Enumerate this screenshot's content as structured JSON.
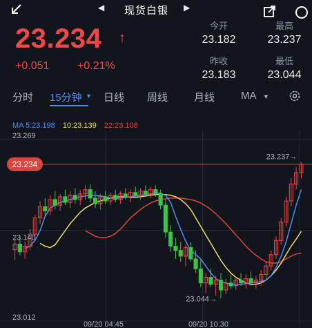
{
  "header": {
    "title": "现货白银",
    "prev_glyph": "◀",
    "next_glyph": "▶",
    "icons": [
      "back-arrow-icon",
      "share-icon",
      "search-icon"
    ]
  },
  "quote": {
    "price": "23.234",
    "arrow": "↑",
    "change": "+0.051",
    "change_pct": "+0.21%",
    "open_label": "今开",
    "open": "23.182",
    "high_label": "最高",
    "high": "23.237",
    "prev_close_label": "昨收",
    "prev_close": "23.183",
    "low_label": "最低",
    "low": "23.044"
  },
  "tabs": {
    "items": [
      "分时",
      "15分钟",
      "日线",
      "周线",
      "月线",
      "MA"
    ],
    "active": "15分钟",
    "dropdown_glyph": "▼"
  },
  "ma_legend": {
    "ma5": "MA 5:23.198",
    "ma10": "10:23.139",
    "ma22": "22:23.108"
  },
  "colors": {
    "up": "#ec4a4a",
    "down": "#3fc24a",
    "accent": "#4f8ff7",
    "ma5": "#4f8ff7",
    "ma10": "#f1dc6a",
    "ma22": "#d6473f",
    "background": "#12161c"
  },
  "chart_data": {
    "type": "candlestick",
    "ylim": [
      23.012,
      23.269
    ],
    "y_tick_labels": [
      "23.269",
      "23.140",
      "23.012"
    ],
    "x_tick_labels": [
      "09/20 04:45",
      "09/20 10:30"
    ],
    "current_price_label": "23.234",
    "high_annotation": "23.237→",
    "low_annotation": "23.044→",
    "candles": [
      [
        23.113,
        23.128,
        23.098,
        23.121
      ],
      [
        23.121,
        23.132,
        23.105,
        23.11
      ],
      [
        23.11,
        23.124,
        23.1,
        23.118
      ],
      [
        23.118,
        23.142,
        23.112,
        23.135
      ],
      [
        23.135,
        23.162,
        23.13,
        23.158
      ],
      [
        23.158,
        23.182,
        23.15,
        23.174
      ],
      [
        23.174,
        23.186,
        23.16,
        23.168
      ],
      [
        23.168,
        23.19,
        23.162,
        23.184
      ],
      [
        23.184,
        23.196,
        23.17,
        23.176
      ],
      [
        23.176,
        23.192,
        23.168,
        23.188
      ],
      [
        23.188,
        23.198,
        23.176,
        23.18
      ],
      [
        23.18,
        23.196,
        23.172,
        23.19
      ],
      [
        23.19,
        23.2,
        23.178,
        23.184
      ],
      [
        23.184,
        23.198,
        23.176,
        23.192
      ],
      [
        23.192,
        23.204,
        23.184,
        23.198
      ],
      [
        23.198,
        23.206,
        23.18,
        23.186
      ],
      [
        23.186,
        23.196,
        23.172,
        23.178
      ],
      [
        23.178,
        23.192,
        23.17,
        23.188
      ],
      [
        23.188,
        23.196,
        23.178,
        23.182
      ],
      [
        23.182,
        23.194,
        23.176,
        23.19
      ],
      [
        23.19,
        23.198,
        23.18,
        23.184
      ],
      [
        23.184,
        23.196,
        23.178,
        23.192
      ],
      [
        23.192,
        23.2,
        23.184,
        23.188
      ],
      [
        23.188,
        23.198,
        23.18,
        23.194
      ],
      [
        23.194,
        23.202,
        23.186,
        23.19
      ],
      [
        23.19,
        23.2,
        23.184,
        23.196
      ],
      [
        23.196,
        23.204,
        23.188,
        23.192
      ],
      [
        23.192,
        23.202,
        23.186,
        23.198
      ],
      [
        23.198,
        23.204,
        23.188,
        23.192
      ],
      [
        23.192,
        23.198,
        23.17,
        23.176
      ],
      [
        23.176,
        23.184,
        23.13,
        23.138
      ],
      [
        23.138,
        23.148,
        23.11,
        23.118
      ],
      [
        23.118,
        23.13,
        23.1,
        23.112
      ],
      [
        23.112,
        23.124,
        23.096,
        23.104
      ],
      [
        23.104,
        23.12,
        23.09,
        23.116
      ],
      [
        23.116,
        23.124,
        23.096,
        23.1
      ],
      [
        23.1,
        23.112,
        23.08,
        23.086
      ],
      [
        23.086,
        23.1,
        23.06,
        23.066
      ],
      [
        23.066,
        23.08,
        23.052,
        23.074
      ],
      [
        23.074,
        23.086,
        23.06,
        23.064
      ],
      [
        23.064,
        23.076,
        23.048,
        23.07
      ],
      [
        23.07,
        23.08,
        23.044,
        23.056
      ],
      [
        23.056,
        23.072,
        23.05,
        23.066
      ],
      [
        23.066,
        23.078,
        23.058,
        23.062
      ],
      [
        23.062,
        23.074,
        23.056,
        23.07
      ],
      [
        23.07,
        23.08,
        23.062,
        23.066
      ],
      [
        23.066,
        23.078,
        23.058,
        23.072
      ],
      [
        23.072,
        23.082,
        23.062,
        23.066
      ],
      [
        23.066,
        23.076,
        23.058,
        23.07
      ],
      [
        23.07,
        23.084,
        23.062,
        23.078
      ],
      [
        23.078,
        23.096,
        23.07,
        23.09
      ],
      [
        23.09,
        23.112,
        23.084,
        23.106
      ],
      [
        23.106,
        23.132,
        23.1,
        23.126
      ],
      [
        23.126,
        23.158,
        23.12,
        23.152
      ],
      [
        23.152,
        23.188,
        23.146,
        23.182
      ],
      [
        23.182,
        23.214,
        23.174,
        23.206
      ],
      [
        23.206,
        23.23,
        23.198,
        23.222
      ],
      [
        23.222,
        23.237,
        23.214,
        23.234
      ]
    ],
    "ma5": [
      23.115,
      23.118,
      23.126,
      23.14,
      23.16,
      23.172,
      23.176,
      23.18,
      23.182,
      23.184,
      23.186,
      23.188,
      23.189,
      23.19,
      23.19,
      23.189,
      23.188,
      23.186,
      23.186,
      23.186,
      23.187,
      23.188,
      23.189,
      23.19,
      23.191,
      23.192,
      23.193,
      23.193,
      23.19,
      23.18,
      23.16,
      23.142,
      23.125,
      23.112,
      23.106,
      23.1,
      23.09,
      23.08,
      23.072,
      23.068,
      23.066,
      23.064,
      23.063,
      23.064,
      23.065,
      23.066,
      23.067,
      23.068,
      23.07,
      23.076,
      23.088,
      23.104,
      23.124,
      23.15,
      23.176,
      23.198
    ],
    "ma10": [
      23.122,
      23.118,
      23.116,
      23.12,
      23.13,
      23.14,
      23.15,
      23.158,
      23.166,
      23.172,
      23.176,
      23.18,
      23.182,
      23.184,
      23.186,
      23.188,
      23.188,
      23.188,
      23.187,
      23.187,
      23.188,
      23.189,
      23.19,
      23.191,
      23.191,
      23.191,
      23.19,
      23.188,
      23.184,
      23.178,
      23.17,
      23.158,
      23.146,
      23.134,
      23.122,
      23.11,
      23.098,
      23.088,
      23.08,
      23.074,
      23.07,
      23.066,
      23.064,
      23.064,
      23.066,
      23.07,
      23.076,
      23.084,
      23.094,
      23.106,
      23.118,
      23.128,
      23.139
    ],
    "ma22": [
      23.14,
      23.136,
      23.132,
      23.13,
      23.13,
      23.132,
      23.136,
      23.142,
      23.15,
      23.158,
      23.164,
      23.17,
      23.175,
      23.179,
      23.182,
      23.184,
      23.185,
      23.186,
      23.186,
      23.186,
      23.185,
      23.184,
      23.182,
      23.179,
      23.175,
      23.17,
      23.164,
      23.157,
      23.15,
      23.142,
      23.134,
      23.126,
      23.118,
      23.111,
      23.105,
      23.1,
      23.096,
      23.094,
      23.094,
      23.096,
      23.1,
      23.104,
      23.107,
      23.108
    ]
  }
}
